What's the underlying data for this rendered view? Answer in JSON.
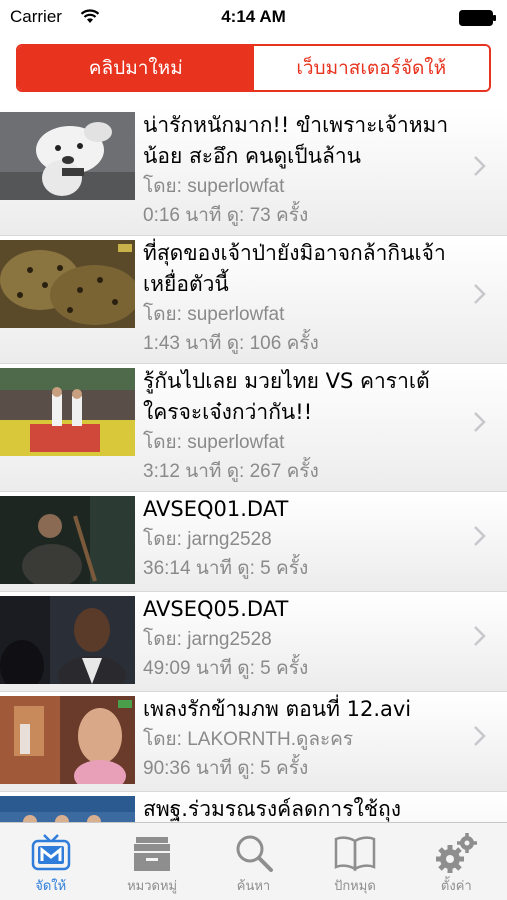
{
  "status": {
    "carrier": "Carrier",
    "time": "4:14 AM"
  },
  "segments": [
    {
      "label": "คลิปมาใหม่",
      "active": true
    },
    {
      "label": "เว็บมาสเตอร์จัดให้",
      "active": false
    }
  ],
  "rows": [
    {
      "title": "น่ารักหนักมาก!! ขำเพราะเจ้าหมาน้อย สะอึก คนดูเป็นล้าน",
      "by": "โดย: superlowfat",
      "stats": "0:16 นาที  ดู: 73 ครั้ง"
    },
    {
      "title": "ที่สุดของเจ้าป่ายังมิอาจกล้ากินเจ้าเหยื่อตัวนี้",
      "by": "โดย: superlowfat",
      "stats": "1:43 นาที  ดู: 106 ครั้ง"
    },
    {
      "title": "รู้กันไปเลย มวยไทย VS คาราเต้ ใครจะเจ๋งกว่ากัน!!",
      "by": "โดย: superlowfat",
      "stats": "3:12 นาที  ดู: 267 ครั้ง"
    },
    {
      "title": "AVSEQ01.DAT",
      "by": "โดย: jarng2528",
      "stats": "36:14 นาที  ดู: 5 ครั้ง"
    },
    {
      "title": "AVSEQ05.DAT",
      "by": "โดย: jarng2528",
      "stats": "49:09 นาที  ดู: 5 ครั้ง"
    },
    {
      "title": "เพลงรักข้ามภพ ตอนที่ 12.avi",
      "by": "โดย: LAKORNTH.ดูละคร",
      "stats": "90:36 นาที  ดู: 5 ครั้ง"
    },
    {
      "title": "สพฐ.ร่วมรณรงค์ลดการใช้ถุง",
      "by": "",
      "stats": ""
    }
  ],
  "tabs": [
    {
      "label": "จัดให้",
      "icon": "m-tv-icon",
      "active": true
    },
    {
      "label": "หมวดหมู่",
      "icon": "archive-icon",
      "active": false
    },
    {
      "label": "ค้นหา",
      "icon": "search-icon",
      "active": false
    },
    {
      "label": "ปักหมุด",
      "icon": "book-icon",
      "active": false
    },
    {
      "label": "ตั้งค่า",
      "icon": "gears-icon",
      "active": false
    }
  ],
  "colors": {
    "accent": "#e8331e",
    "tab_active": "#2f7cdb",
    "meta_gray": "#8a8a8a"
  }
}
